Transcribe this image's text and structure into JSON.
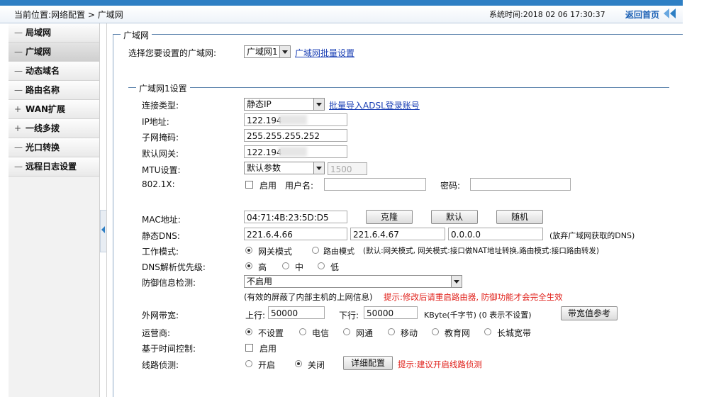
{
  "header": {
    "breadcrumb": "当前位置:网络配置 > 广域网",
    "system_time": "系统时间:2018 02 06 17:30:37",
    "home_link": "返回首页"
  },
  "sidebar": {
    "items": [
      {
        "marker": "—",
        "label": "局域网"
      },
      {
        "marker": "—",
        "label": "广域网"
      },
      {
        "marker": "—",
        "label": "动态域名"
      },
      {
        "marker": "—",
        "label": "路由名称"
      },
      {
        "marker": "+",
        "label": "WAN扩展"
      },
      {
        "marker": "+",
        "label": "一线多拨"
      },
      {
        "marker": "—",
        "label": "光口转换"
      },
      {
        "marker": "—",
        "label": "远程日志设置"
      }
    ]
  },
  "wan_section": {
    "legend": "广域网",
    "select_label": "选择您要设置的广域网:",
    "select_value": "广域网1",
    "batch_link": "广域网批量设置"
  },
  "wan1": {
    "legend": "广域网1设置",
    "conn_type_label": "连接类型:",
    "conn_type_value": "静态IP",
    "adsl_link": "批量导入ADSL登录账号",
    "ip_label": "IP地址:",
    "ip_value": "122.194",
    "mask_label": "子网掩码:",
    "mask_value": "255.255.255.252",
    "gateway_label": "默认网关:",
    "gateway_value": "122.194",
    "mtu_label": "MTU设置:",
    "mtu_select": "默认参数",
    "mtu_value": "1500",
    "dot1x_label": "802.1X:",
    "dot1x_enable": "启用",
    "username_label": "用户名:",
    "password_label": "密码:",
    "mac_label": "MAC地址:",
    "mac_value": "04:71:4B:23:5D:D5",
    "clone_btn": "克隆",
    "default_btn": "默认",
    "random_btn": "随机",
    "dns_label": "静态DNS:",
    "dns1": "221.6.4.66",
    "dns2": "221.6.4.67",
    "dns3": "0.0.0.0",
    "dns_note": "(放弃广域网获取的DNS)",
    "mode_label": "工作模式:",
    "mode_gateway": "网关模式",
    "mode_router": "路由模式",
    "mode_note": "(默认:网关模式, 网关模式:接口做NAT地址转换,路由模式:接口路由转发)",
    "dns_priority_label": "DNS解析优先级:",
    "priority_high": "高",
    "priority_mid": "中",
    "priority_low": "低",
    "defense_label": "防御信息检测:",
    "defense_value": "不启用",
    "defense_note": "(有效的屏蔽了内部主机的上网信息)",
    "defense_hint": "提示:修改后请重启路由器, 防御功能才会完全生效",
    "bandwidth_label": "外网带宽:",
    "upload_label": "上行:",
    "upload_value": "50000",
    "download_label": "下行:",
    "download_value": "50000",
    "bandwidth_unit": "KByte(千字节) (0 表示不设置)",
    "bandwidth_ref_btn": "带宽值参考",
    "isp_label": "运营商:",
    "isp_options": [
      "不设置",
      "电信",
      "网通",
      "移动",
      "教育网",
      "长城宽带"
    ],
    "time_ctrl_label": "基于时间控制:",
    "time_ctrl_enable": "启用",
    "line_detect_label": "线路侦测:",
    "line_on": "开启",
    "line_off": "关闭",
    "detail_btn": "详细配置",
    "line_hint": "提示:建议开启线路侦测"
  }
}
